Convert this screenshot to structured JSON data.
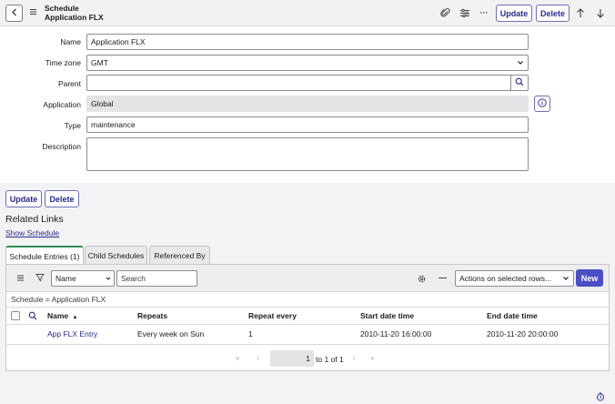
{
  "header": {
    "title_line1": "Schedule",
    "title_line2": "Application FLX",
    "update_label": "Update",
    "delete_label": "Delete",
    "more_label": "···"
  },
  "form": {
    "name_label": "Name",
    "name_value": "Application FLX",
    "timezone_label": "Time zone",
    "timezone_value": "GMT",
    "parent_label": "Parent",
    "parent_value": "",
    "application_label": "Application",
    "application_value": "Global",
    "type_label": "Type",
    "type_value": "maintenance",
    "description_label": "Description",
    "description_value": ""
  },
  "actions": {
    "update_label": "Update",
    "delete_label": "Delete"
  },
  "related": {
    "title": "Related Links",
    "show_schedule": "Show Schedule"
  },
  "tabs": [
    {
      "label": "Schedule Entries (1)",
      "active": true
    },
    {
      "label": "Child Schedules",
      "active": false
    },
    {
      "label": "Referenced By",
      "active": false
    }
  ],
  "list": {
    "search_field": "Name",
    "search_placeholder": "Search",
    "actions_select": "Actions on selected rows...",
    "new_label": "New",
    "breadcrumb": "Schedule = Application FLX",
    "columns": [
      "Name",
      "Repeats",
      "Repeat every",
      "Start date time",
      "End date time"
    ],
    "sort_indicator": "▲",
    "rows": [
      {
        "name": "App FLX Entry",
        "repeats": "Every week on Sun",
        "repeat_every": "1",
        "start": "2010-11-20 16:00:00",
        "end": "2010-11-20 20:00:00"
      }
    ],
    "pagination": {
      "page": "1",
      "range_text": "to 1 of 1"
    }
  },
  "colors": {
    "accent": "#292b8a",
    "active_tab": "#2e8a56",
    "new_button": "#4b4ec2"
  }
}
